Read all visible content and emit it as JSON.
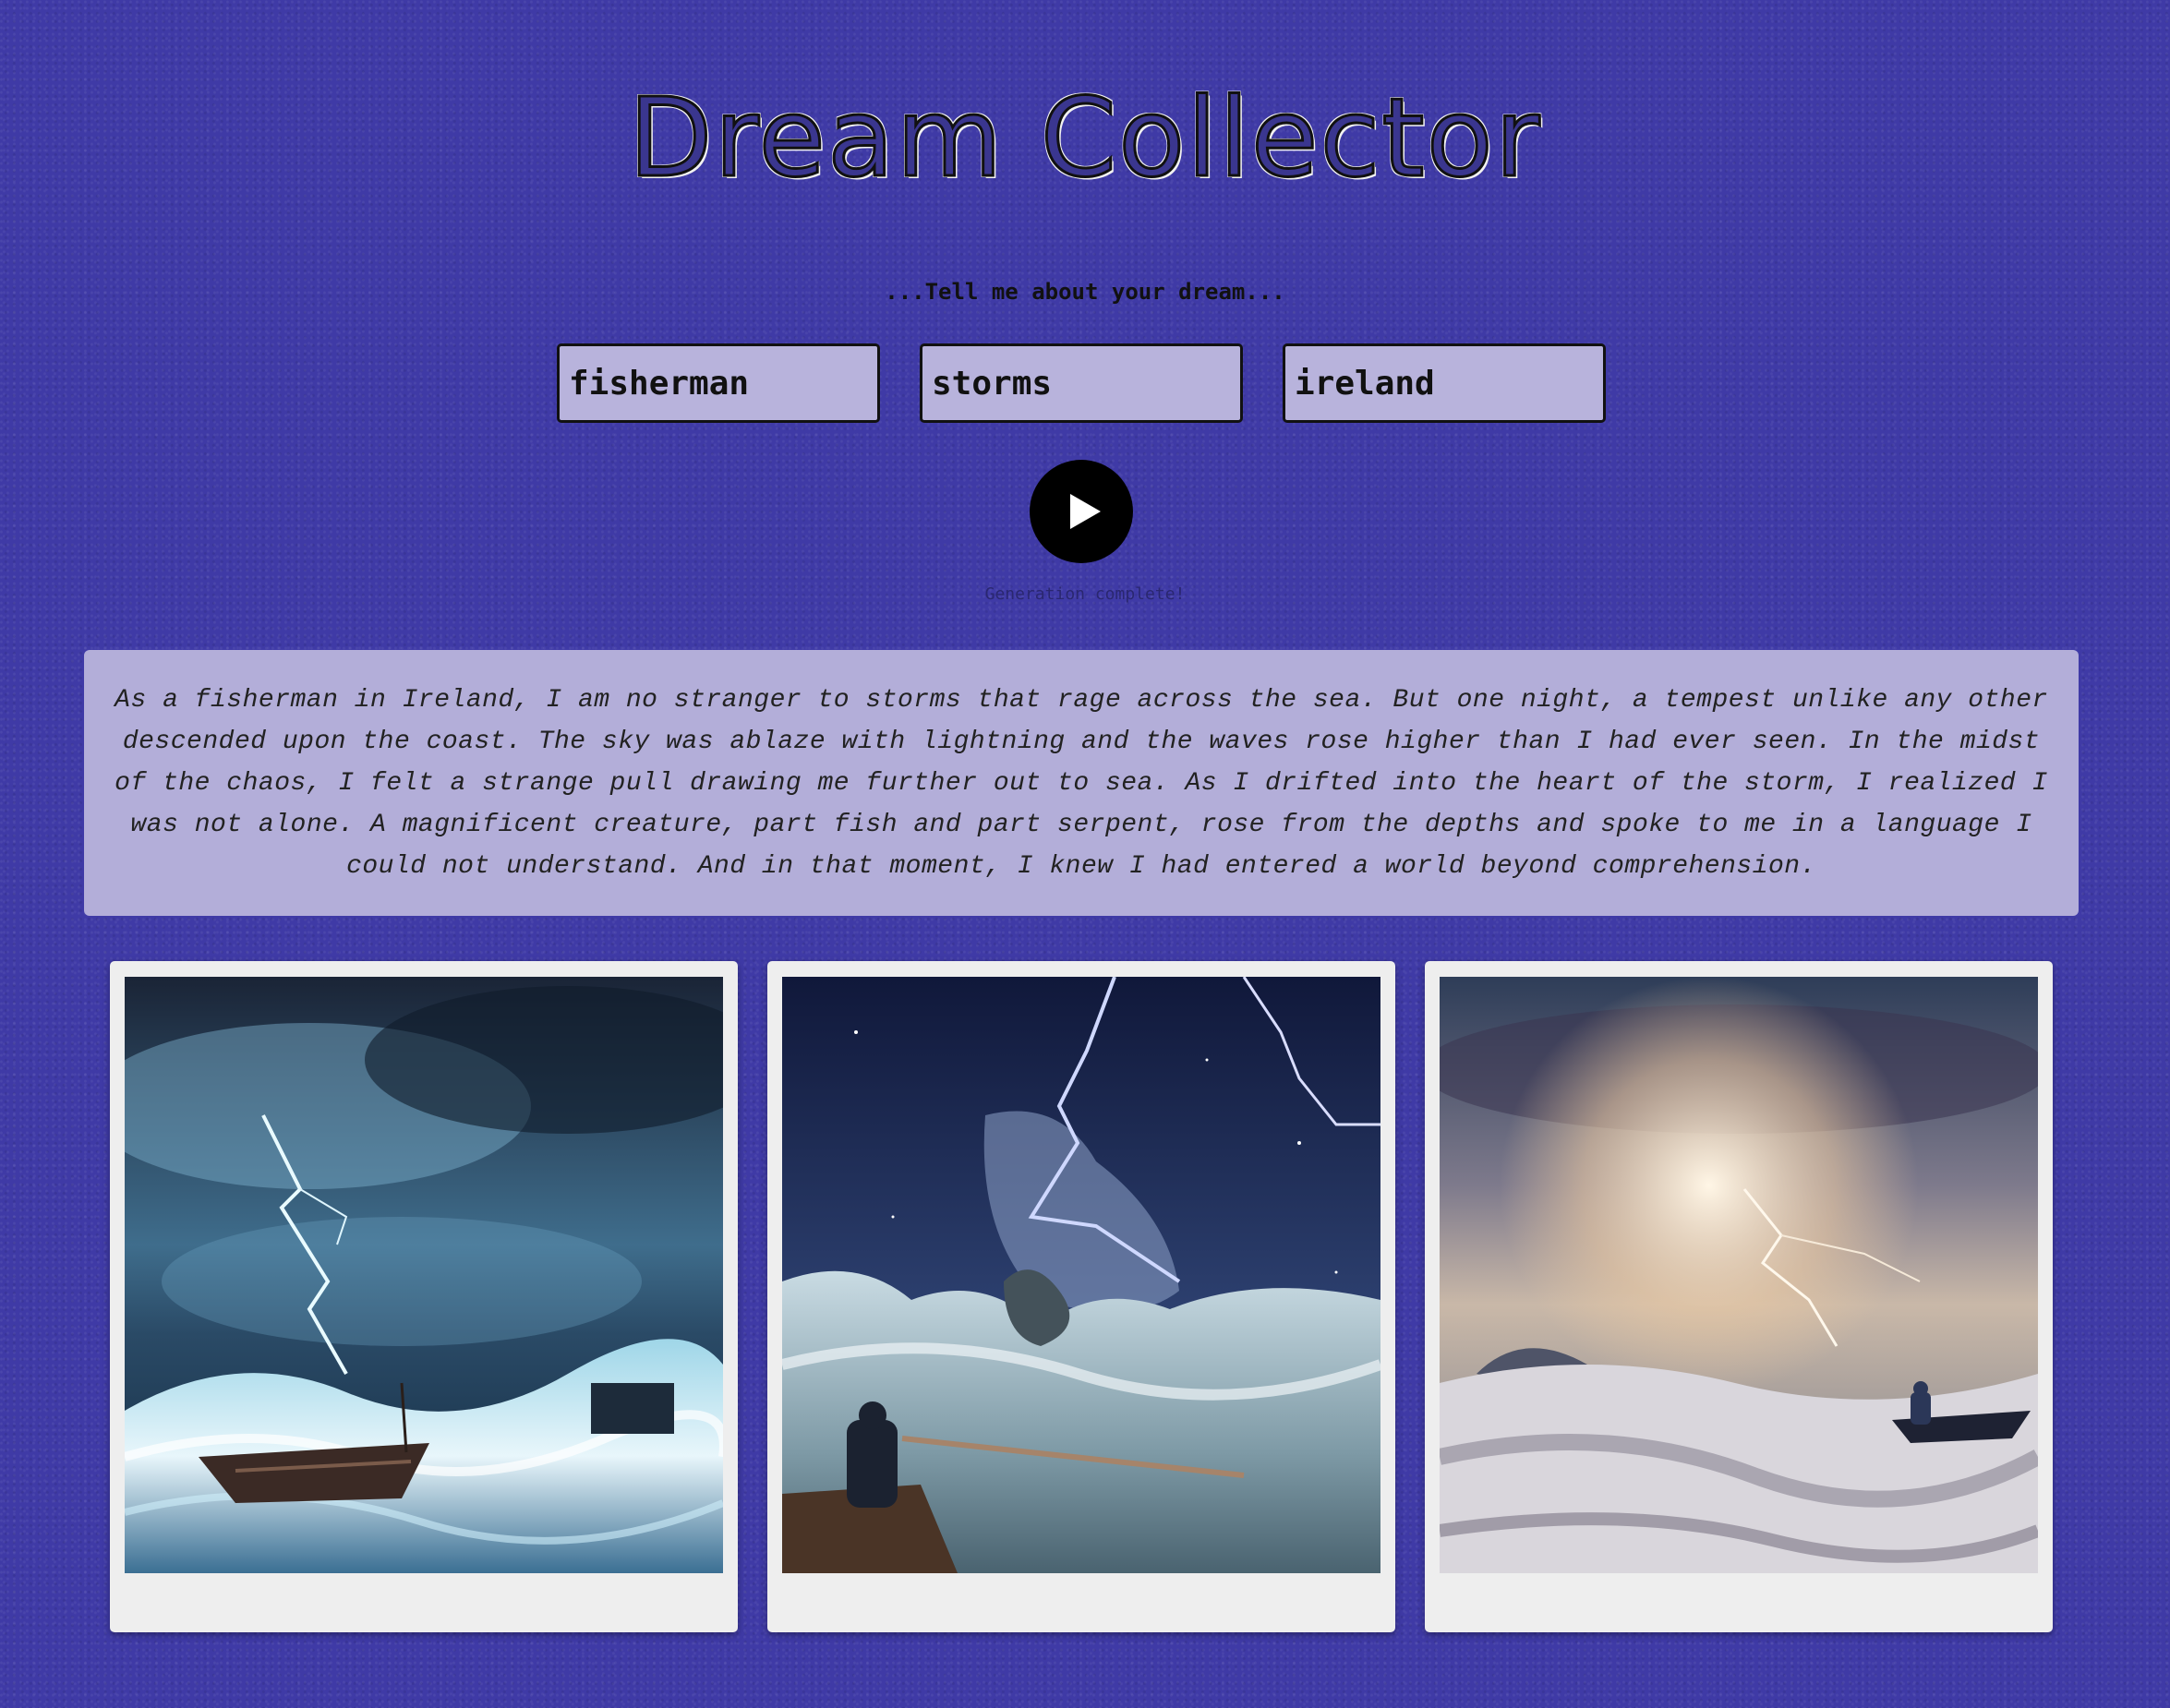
{
  "app": {
    "title": "Dream Collector"
  },
  "prompt": {
    "text": "...Tell me about your dream..."
  },
  "inputs": [
    {
      "value": "fisherman"
    },
    {
      "value": "storms"
    },
    {
      "value": "ireland"
    }
  ],
  "controls": {
    "play_icon": "play-icon"
  },
  "status": {
    "text": "Generation complete!"
  },
  "story": {
    "text": "As a fisherman in Ireland, I am no stranger to storms that rage across the sea. But one night, a tempest unlike any other descended upon the coast. The sky was ablaze with lightning and the waves rose higher than I had ever seen. In the midst of the chaos, I felt a strange pull drawing me further out to sea. As I drifted into the heart of the storm, I realized I was not alone. A magnificent creature, part fish and part serpent, rose from the depths and spoke to me in a language I could not understand. And in that moment, I knew I had entered a world beyond comprehension."
  },
  "colors": {
    "background": "#3f3aa6",
    "panel": "#b3aed9",
    "input": "#b8b3dc",
    "card": "#eeeeee"
  }
}
